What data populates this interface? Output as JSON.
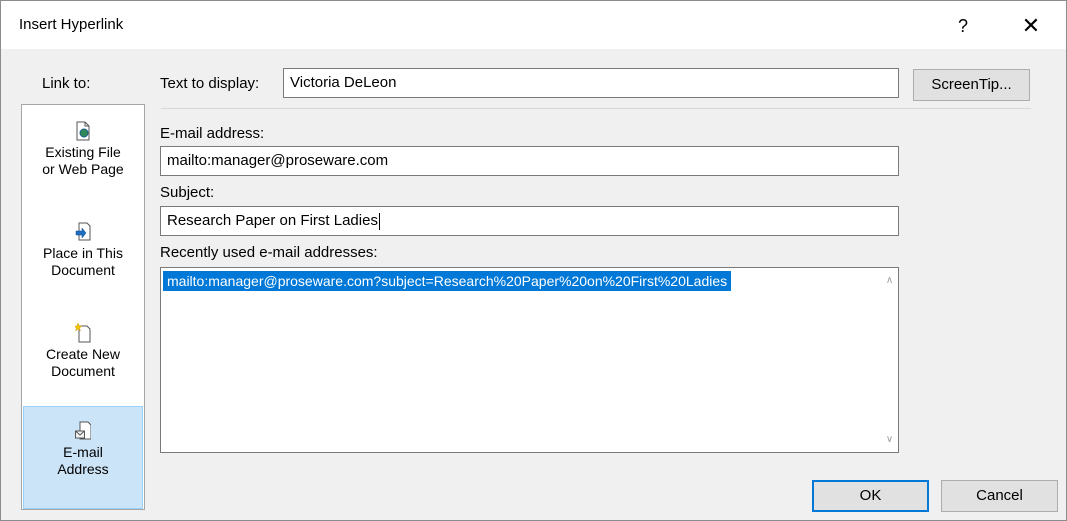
{
  "window": {
    "title": "Insert Hyperlink",
    "help_label": "?",
    "close_label": "✕"
  },
  "link_to": {
    "label": "Link to:",
    "items": [
      {
        "line1": "Existing File",
        "line2": "or Web Page",
        "icon": "document-globe-icon"
      },
      {
        "line1": "Place in This",
        "line2": "Document",
        "icon": "document-arrow-icon"
      },
      {
        "line1": "Create New",
        "line2": "Document",
        "icon": "new-document-icon"
      },
      {
        "line1": "E-mail",
        "line2": "Address",
        "icon": "email-document-icon",
        "selected": true
      }
    ]
  },
  "text_to_display": {
    "label": "Text to display:",
    "value": "Victoria DeLeon"
  },
  "screentip_label": "ScreenTip...",
  "email_address": {
    "label": "E-mail address:",
    "value": "mailto:manager@proseware.com"
  },
  "subject": {
    "label": "Subject:",
    "value": "Research Paper on First Ladies"
  },
  "recent": {
    "label": "Recently used e-mail addresses:",
    "items": [
      "mailto:manager@proseware.com?subject=Research%20Paper%20on%20First%20Ladies"
    ]
  },
  "buttons": {
    "ok": "OK",
    "cancel": "Cancel"
  },
  "colors": {
    "accent": "#0078d7",
    "selection_bg": "#cce4f7"
  }
}
